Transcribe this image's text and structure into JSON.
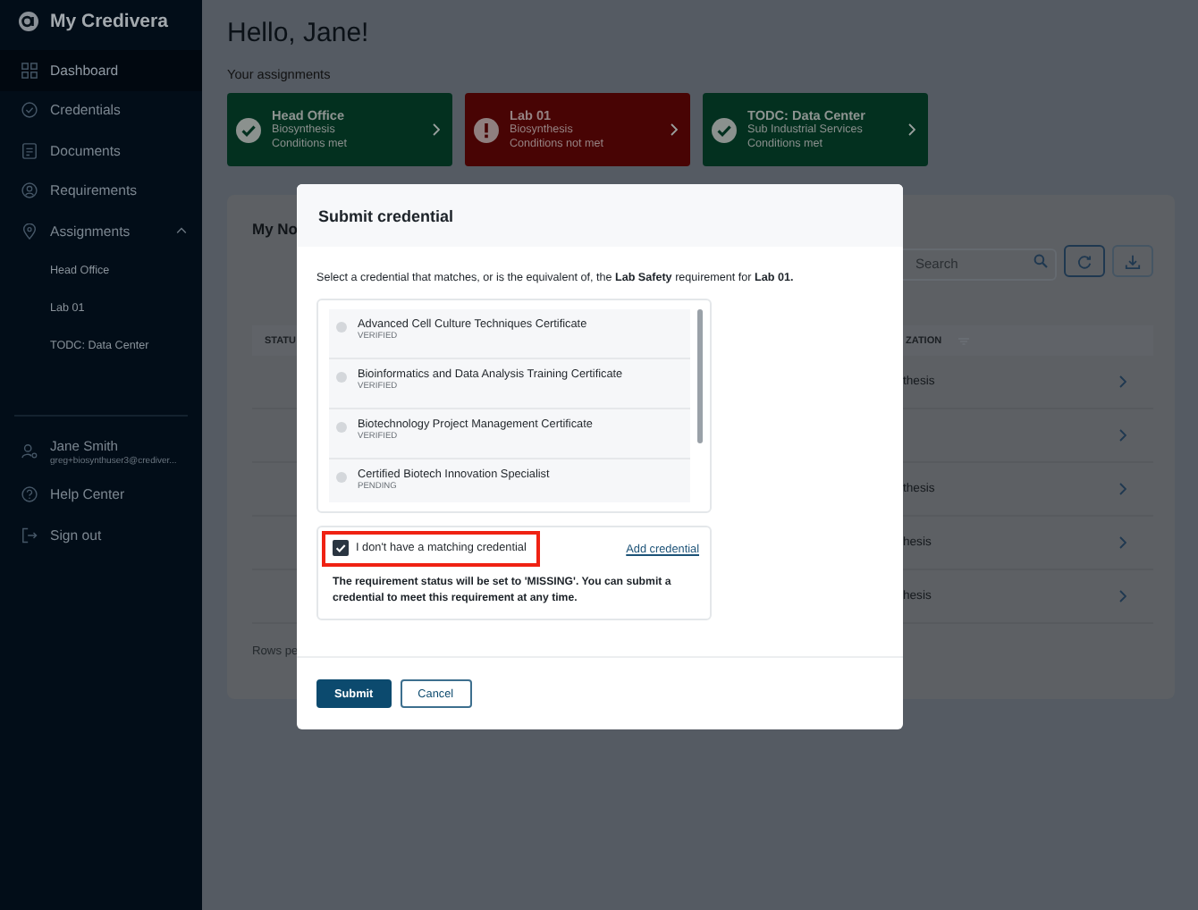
{
  "sidebar": {
    "brand": "My Credivera",
    "items": [
      {
        "label": "Dashboard",
        "kind": "grid",
        "selected": true
      },
      {
        "label": "Credentials",
        "kind": "check",
        "selected": false
      },
      {
        "label": "Documents",
        "kind": "doc",
        "selected": false
      },
      {
        "label": "Requirements",
        "kind": "person",
        "selected": false
      },
      {
        "label": "Assignments",
        "kind": "pin",
        "selected": false,
        "expanded": true,
        "children": [
          {
            "label": "Head Office"
          },
          {
            "label": "Lab 01"
          },
          {
            "label": "TODC: Data Center"
          }
        ]
      }
    ],
    "user": {
      "name": "Jane Smith",
      "email": "greg+biosynthuser3@crediver..."
    },
    "bottom": [
      {
        "label": "Help Center",
        "kind": "help"
      },
      {
        "label": "Sign out",
        "kind": "exit"
      }
    ]
  },
  "main": {
    "greeting": "Hello, Jane!",
    "assignments_label": "Your assignments",
    "assignments": [
      {
        "title": "Head Office",
        "org": "Biosynthesis",
        "status": "Conditions met",
        "met": true
      },
      {
        "title": "Lab 01",
        "org": "Biosynthesis",
        "status": "Conditions not met",
        "met": false
      },
      {
        "title": "TODC: Data Center",
        "org": "Sub Industrial Services",
        "status": "Conditions met",
        "met": true
      }
    ],
    "panel": {
      "title": "My No",
      "search": {
        "placeholder": "Search"
      },
      "column_1": "STATU",
      "column_2": "ZATION",
      "rows": [
        "thesis",
        "",
        "thesis",
        "hesis",
        "hesis"
      ],
      "footer": "Rows pe"
    }
  },
  "modal": {
    "title": "Submit credential",
    "prompt": "Select a credential that matches, or is the equivalent of, the **Lab Safety** requirement for **Lab 01.**",
    "credentials": [
      {
        "name": "Advanced Cell Culture Techniques Certificate",
        "status": "VERIFIED",
        "selected": false
      },
      {
        "name": "Bioinformatics and Data Analysis Training Certificate",
        "status": "VERIFIED",
        "selected": false
      },
      {
        "name": "Biotechnology Project Management Certificate",
        "status": "VERIFIED",
        "selected": false
      },
      {
        "name": "Certified Biotech Innovation Specialist",
        "status": "PENDING",
        "selected": false
      }
    ],
    "no_match": {
      "label": "I don't have a matching credential",
      "checked": true,
      "highlighted": true
    },
    "add_link": "Add credential",
    "note": "The requirement status will be set to 'MISSING'. You can submit a credential to meet this requirement at any time.",
    "buttons": [
      {
        "label": "Submit",
        "kind": "primary"
      },
      {
        "label": "Cancel",
        "kind": "secondary"
      }
    ]
  }
}
